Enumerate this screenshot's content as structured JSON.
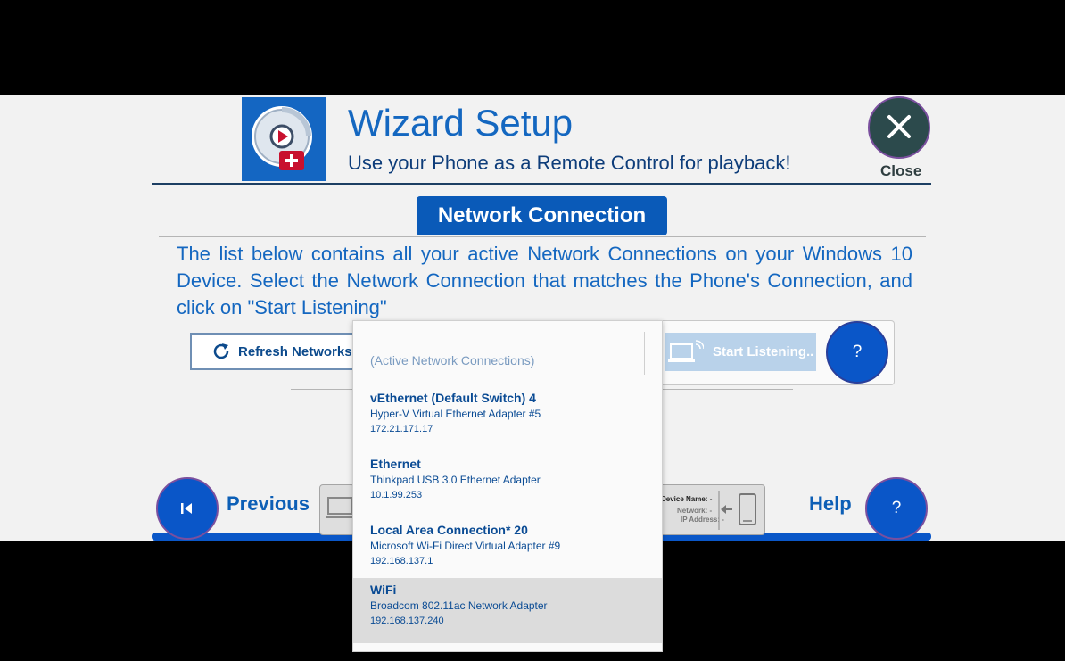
{
  "header": {
    "title": "Wizard Setup",
    "subtitle": "Use your Phone as a Remote Control for playback!",
    "close_label": "Close",
    "close_icon": "x-icon",
    "logo_icon": "remote-play-logo"
  },
  "section": {
    "title": "Network Connection",
    "description": "The list below contains all your active Network Connections on your Windows 10 Device. Select the Network Connection that matches the Phone's Connection, and click on \"Start Listening\""
  },
  "controls": {
    "refresh_label": "Refresh Networks",
    "refresh_icon": "refresh-icon",
    "start_label": "Start Listening..",
    "start_icon": "laptop-broadcast-icon",
    "help_symbol": "?"
  },
  "dropdown": {
    "header": "(Active Network Connections)",
    "items": [
      {
        "name": "vEthernet (Default Switch) 4",
        "adapter": "Hyper-V Virtual Ethernet Adapter #5",
        "ip": "172.21.171.17"
      },
      {
        "name": "Ethernet",
        "adapter": "Thinkpad USB 3.0 Ethernet Adapter",
        "ip": "10.1.99.253"
      },
      {
        "name": "Local Area Connection* 20",
        "adapter": "Microsoft Wi-Fi Direct Virtual Adapter #9",
        "ip": "192.168.137.1"
      },
      {
        "name": "WiFi",
        "adapter": "Broadcom 802.11ac Network Adapter",
        "ip": "192.168.137.240"
      }
    ],
    "selected_index": 3
  },
  "footer": {
    "previous_label": "Previous",
    "help_label": "Help",
    "help_symbol": "?",
    "status": {
      "device_name": "Device Name: -",
      "network": "Network: -",
      "ip_address": "IP Address: -"
    }
  },
  "colors": {
    "accent": "#0a56c8",
    "title": "#1467c0",
    "close_bg": "#2c4a4c"
  }
}
